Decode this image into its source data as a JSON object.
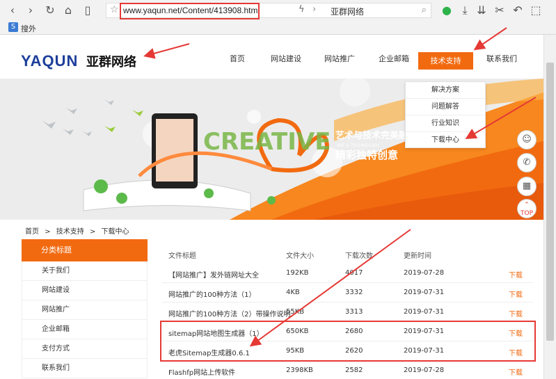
{
  "browser": {
    "url": "www.yaqun.net/Content/413908.html",
    "tab_title": "亚群网络",
    "bookmark": "搜外"
  },
  "site": {
    "logo_latin": "YAQUN",
    "logo_cn": "亚群网络",
    "nav": [
      "首页",
      "网站建设",
      "网站推广",
      "企业邮箱",
      "技术支持",
      "联系我们"
    ],
    "dropdown": [
      "解决方案",
      "问题解答",
      "行业知识",
      "下载中心"
    ]
  },
  "banner": {
    "word": "CREATIVE",
    "slogan1": "艺术与技术完美融",
    "slogan_en": "ART & TECHNOLOGY",
    "slogan2": "精彩独特创意"
  },
  "float": {
    "top_label": "TOP"
  },
  "breadcrumb": [
    "首页",
    ">",
    "技术支持",
    ">",
    "下载中心"
  ],
  "sidebar": {
    "title": "分类标题",
    "items": [
      "关于我们",
      "网站建设",
      "网站推广",
      "企业邮箱",
      "支付方式",
      "联系我们"
    ]
  },
  "table": {
    "headers": [
      "文件标题",
      "文件大小",
      "下载次数",
      "更新时间"
    ],
    "rows": [
      {
        "title": "【网站推广】发外链网址大全",
        "size": "192KB",
        "count": "4017",
        "date": "2019-07-28",
        "action": "下载"
      },
      {
        "title": "网站推广的100种方法（1）",
        "size": "4KB",
        "count": "3332",
        "date": "2019-07-31",
        "action": "下载"
      },
      {
        "title": "网站推广的100种方法（2）带操作说明",
        "size": "55KB",
        "count": "3313",
        "date": "2019-07-31",
        "action": "下载"
      },
      {
        "title": "sitemap网站地图生成器（1）",
        "size": "650KB",
        "count": "2680",
        "date": "2019-07-31",
        "action": "下载"
      },
      {
        "title": "老虎Sitemap生成器0.6.1",
        "size": "95KB",
        "count": "2620",
        "date": "2019-07-31",
        "action": "下载"
      },
      {
        "title": "Flashfp网站上传软件",
        "size": "2398KB",
        "count": "2582",
        "date": "2019-07-28",
        "action": "下载"
      }
    ]
  },
  "colors": {
    "accent": "#f26a10",
    "annotation": "#e53935",
    "logo_blue": "#1d3f9a"
  }
}
